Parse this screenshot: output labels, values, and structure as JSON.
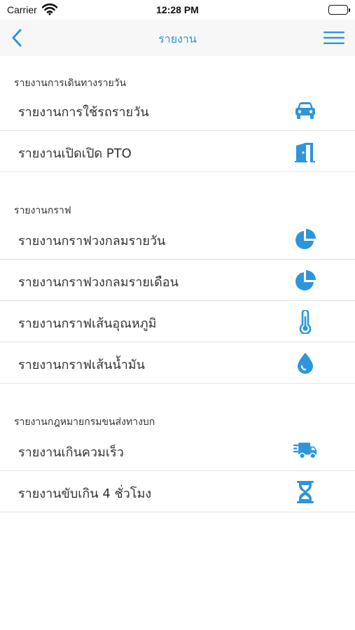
{
  "status_bar": {
    "carrier": "Carrier",
    "time": "12:28 PM"
  },
  "nav": {
    "title": "รายงาน",
    "back_icon": "chevron-left-icon",
    "menu_icon": "hamburger-menu-icon"
  },
  "accent_color": "#2e95db",
  "sections": [
    {
      "header": "รายงานการเดินทางรายวัน",
      "items": [
        {
          "label": "รายงานการใช้รถรายวัน",
          "icon": "car-icon"
        },
        {
          "label": "รายงานเปิดเปิด PTO",
          "icon": "door-icon"
        }
      ]
    },
    {
      "header": "รายงานกราฟ",
      "items": [
        {
          "label": "รายงานกราฟวงกลมรายวัน",
          "icon": "pie-chart-icon"
        },
        {
          "label": "รายงานกราฟวงกลมรายเดือน",
          "icon": "pie-chart-icon"
        },
        {
          "label": "รายงานกราฟเส้นอุณหภูมิ",
          "icon": "thermometer-icon"
        },
        {
          "label": "รายงานกราฟเส้นน้ำมัน",
          "icon": "fuel-drop-icon"
        }
      ]
    },
    {
      "header": "รายงานกฎหมายกรมขนส่งทางบก",
      "items": [
        {
          "label": "รายงานเกินควมเร็ว",
          "icon": "fast-truck-icon"
        },
        {
          "label": "รายงานขับเกิน 4 ชั่วโมง",
          "icon": "hourglass-icon"
        }
      ]
    }
  ]
}
